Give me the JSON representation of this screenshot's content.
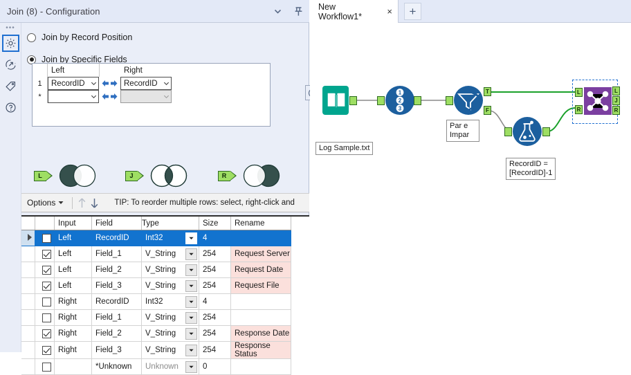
{
  "panel": {
    "title": "Join (8) - Configuration",
    "header_icons": [
      {
        "name": "chevron-down-icon",
        "glyph": "chevron-down"
      },
      {
        "name": "pin-icon",
        "glyph": "pin"
      }
    ],
    "rail": [
      {
        "name": "configuration-gear-icon",
        "label": "Configuration",
        "active": true
      },
      {
        "name": "output-arrow-icon",
        "label": "Output",
        "active": false
      },
      {
        "name": "annotation-tag-icon",
        "label": "Annotation",
        "active": false
      },
      {
        "name": "help-question-icon",
        "label": "Help",
        "active": false
      }
    ],
    "radios": [
      {
        "label": "Join by Record Position",
        "checked": false
      },
      {
        "label": "Join by Specific Fields",
        "checked": true
      }
    ],
    "join_fields": {
      "headers": [
        "",
        "Left",
        "",
        "Right"
      ],
      "rows": [
        {
          "index": "1",
          "left": "RecordID",
          "right": "RecordID",
          "right_disabled": false
        },
        {
          "index": "*",
          "left": "",
          "right": "",
          "right_disabled": true
        }
      ]
    },
    "remove_button": {
      "name": "remove-join-field-button",
      "glyph": "minus-circle"
    },
    "venns": [
      {
        "tag": "L",
        "fill": "left"
      },
      {
        "tag": "J",
        "fill": "center"
      },
      {
        "tag": "R",
        "fill": "right"
      }
    ],
    "options_bar": {
      "options_label": "Options",
      "move_up": "move-up-arrow",
      "move_down": "move-down-arrow",
      "tip": "TIP: To reorder multiple rows: select, right-click and"
    },
    "field_grid": {
      "columns": [
        "",
        "",
        "Input",
        "Field",
        "Type",
        "Size",
        "Rename"
      ],
      "rows": [
        {
          "checked": false,
          "selected": true,
          "input": "Left",
          "field": "RecordID",
          "type": "Int32",
          "size": "4",
          "rename": "",
          "size_muted": false,
          "type_muted": false
        },
        {
          "checked": true,
          "selected": false,
          "input": "Left",
          "field": "Field_1",
          "type": "V_String",
          "size": "254",
          "rename": "Request Server",
          "size_muted": false,
          "type_muted": false
        },
        {
          "checked": true,
          "selected": false,
          "input": "Left",
          "field": "Field_2",
          "type": "V_String",
          "size": "254",
          "rename": "Request Date",
          "size_muted": false,
          "type_muted": false
        },
        {
          "checked": true,
          "selected": false,
          "input": "Left",
          "field": "Field_3",
          "type": "V_String",
          "size": "254",
          "rename": "Request File",
          "size_muted": false,
          "type_muted": false
        },
        {
          "checked": false,
          "selected": false,
          "input": "Right",
          "field": "RecordID",
          "type": "Int32",
          "size": "4",
          "rename": "",
          "size_muted": true,
          "type_muted": false
        },
        {
          "checked": false,
          "selected": false,
          "input": "Right",
          "field": "Field_1",
          "type": "V_String",
          "size": "254",
          "rename": "",
          "size_muted": false,
          "type_muted": false
        },
        {
          "checked": true,
          "selected": false,
          "input": "Right",
          "field": "Field_2",
          "type": "V_String",
          "size": "254",
          "rename": "Response Date",
          "size_muted": false,
          "type_muted": false
        },
        {
          "checked": true,
          "selected": false,
          "input": "Right",
          "field": "Field_3",
          "type": "V_String",
          "size": "254",
          "rename": "Response Status",
          "size_muted": false,
          "type_muted": false
        },
        {
          "checked": false,
          "selected": false,
          "input": "",
          "field": "*Unknown",
          "type": "Unknown",
          "size": "0",
          "rename": "",
          "size_muted": true,
          "type_muted": true
        }
      ]
    }
  },
  "workspace": {
    "tabs": [
      {
        "label": "New Workflow1*",
        "close": "×",
        "active": true
      }
    ],
    "add_tab": "+",
    "nodes": [
      {
        "id": "input-data-node",
        "icon": "book-icon",
        "label": "Log Sample.txt",
        "color": "#00a58e"
      },
      {
        "id": "record-id-node",
        "icon": "numbers-icon",
        "label": "",
        "color": "#1c5f9e"
      },
      {
        "id": "filter-node",
        "icon": "filter-icon",
        "label": "Par e\nImpar",
        "color": "#1c5f9e"
      },
      {
        "id": "formula-node",
        "icon": "flask-icon",
        "label": "RecordID =\n[RecordID]-1",
        "color": "#1c5f9e"
      },
      {
        "id": "join-node",
        "icon": "join-icon",
        "label": "",
        "color": "#7b3fa0"
      }
    ],
    "ports": {
      "filter_true": "T",
      "filter_false": "F",
      "join_left": "L",
      "join_right": "R",
      "join_out_l": "L",
      "join_out_j": "J",
      "join_out_r": "R"
    },
    "colors": {
      "connection_active": "#1aa12a",
      "connection_idle": "#8a8a8a",
      "selection": "#1f6fd0"
    }
  }
}
